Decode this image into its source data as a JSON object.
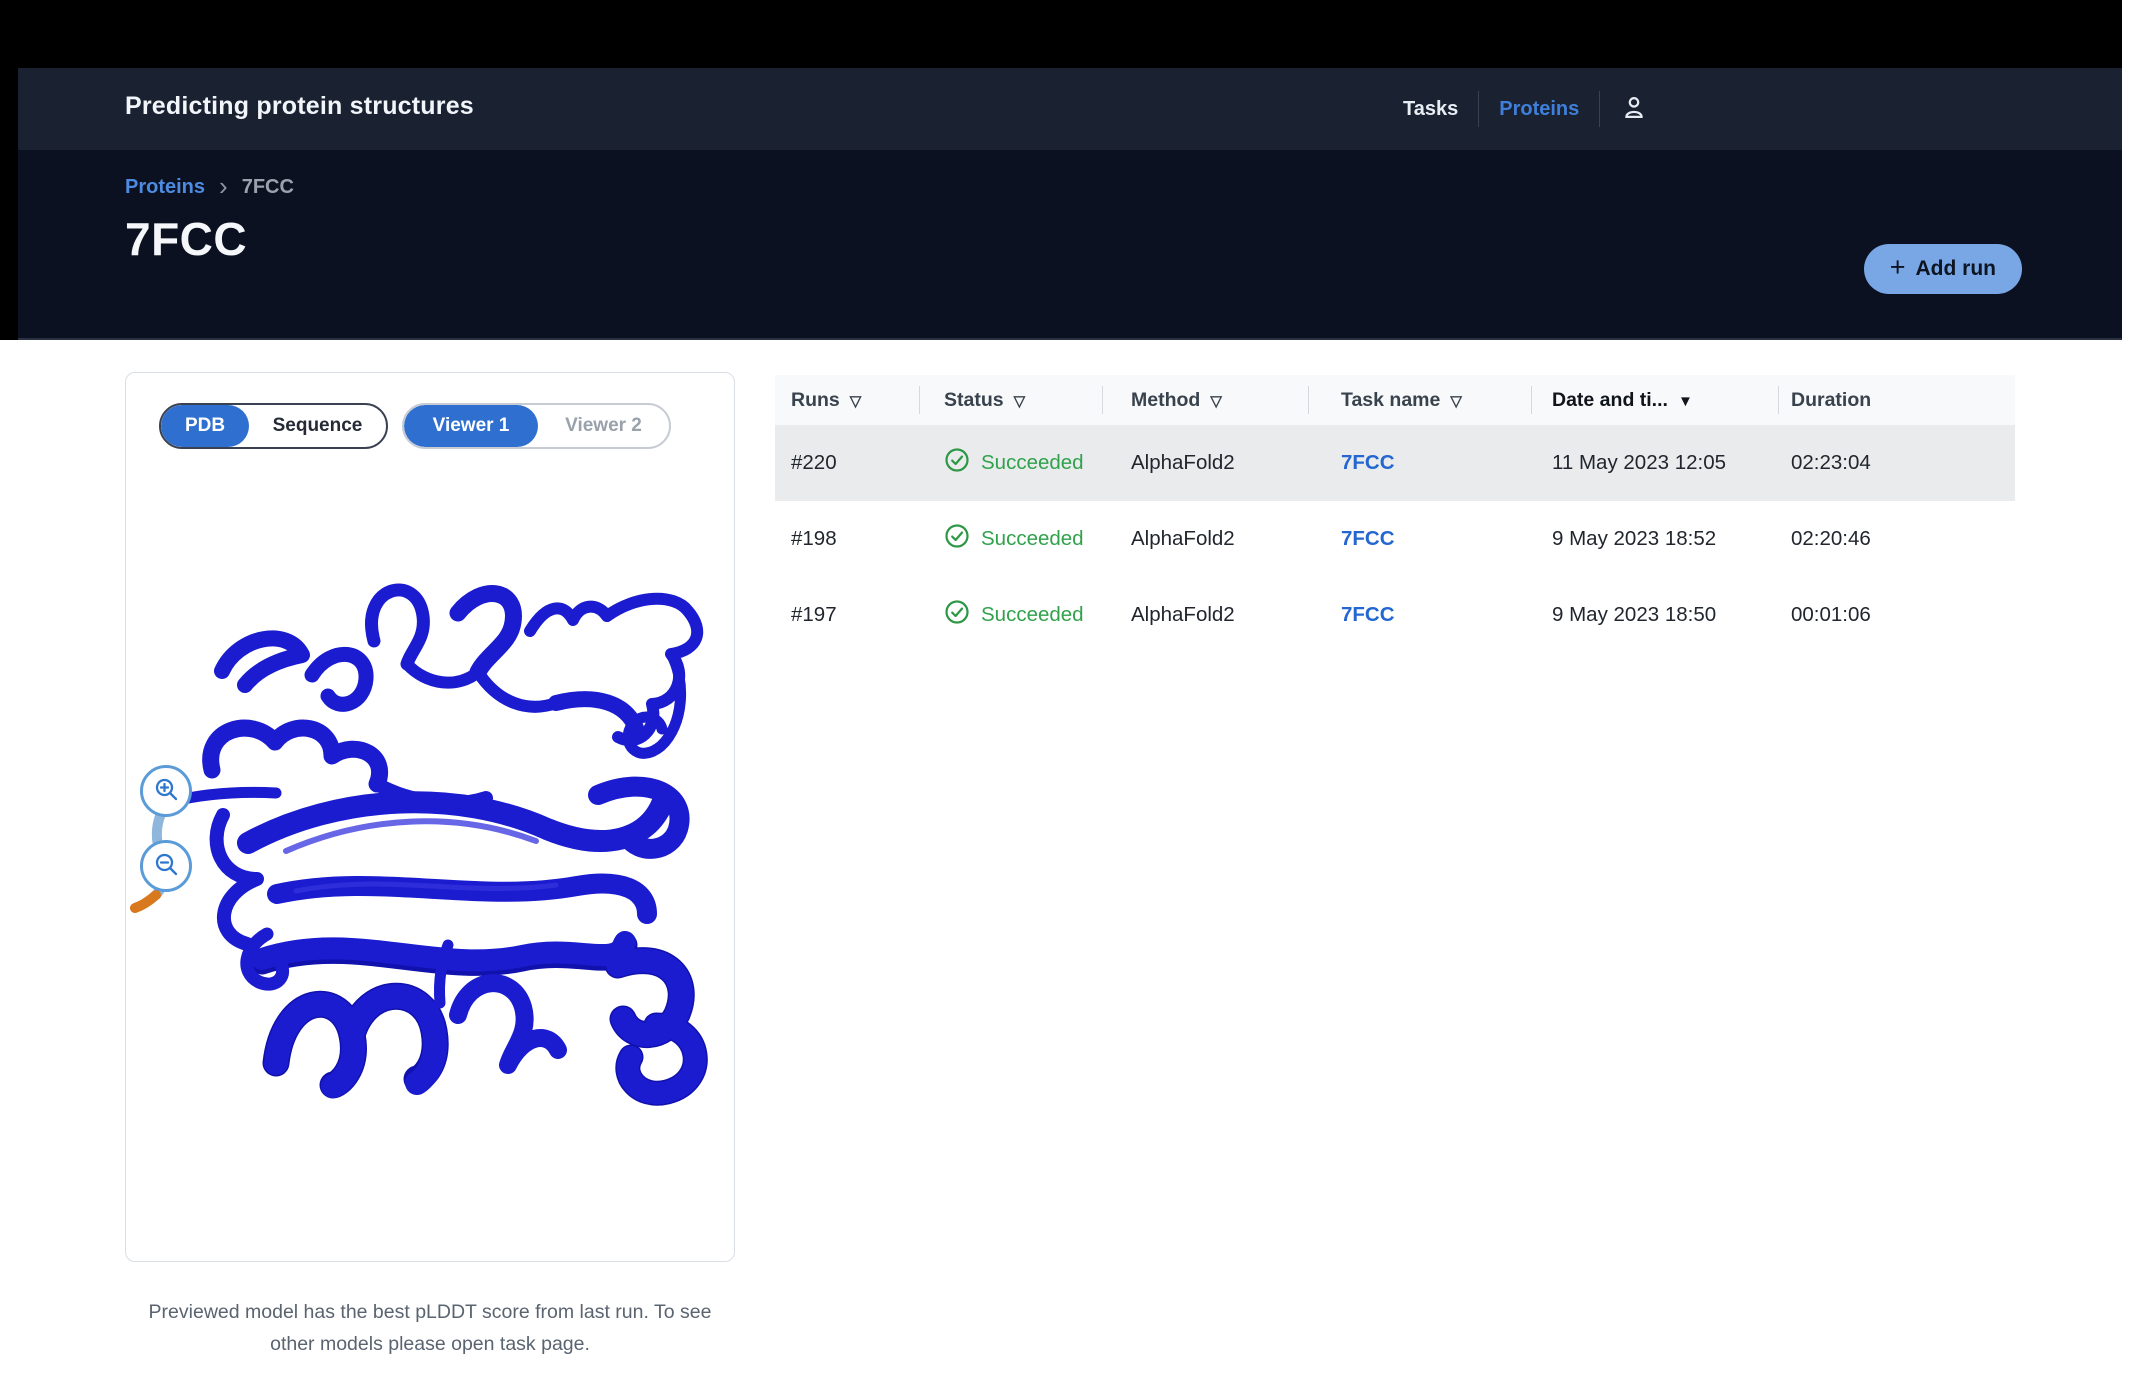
{
  "header": {
    "app_title": "Predicting protein structures",
    "nav": [
      {
        "label": "Tasks",
        "active": false
      },
      {
        "label": "Proteins",
        "active": true
      }
    ]
  },
  "breadcrumb": {
    "root": "Proteins",
    "current": "7FCC"
  },
  "hero": {
    "title": "7FCC",
    "add_run": {
      "label": "Add run"
    }
  },
  "viewer": {
    "format_toggle": {
      "options": [
        "PDB",
        "Sequence"
      ],
      "selected": "PDB"
    },
    "viewer_toggle": {
      "options": [
        "Viewer 1",
        "Viewer 2"
      ],
      "selected": "Viewer 1"
    },
    "caption": "Previewed model has the best pLDDT score from last run. To see other models please open task page."
  },
  "table": {
    "columns": [
      {
        "label": "Runs",
        "icon": "filter"
      },
      {
        "label": "Status",
        "icon": "filter"
      },
      {
        "label": "Method",
        "icon": "filter"
      },
      {
        "label": "Task name",
        "icon": "filter"
      },
      {
        "label": "Date and ti...",
        "icon": "sort-desc"
      },
      {
        "label": "Duration",
        "icon": ""
      }
    ],
    "rows": [
      {
        "run": "#220",
        "status": "Succeeded",
        "method": "AlphaFold2",
        "task_name": "7FCC",
        "date": "11 May 2023 12:05",
        "duration": "02:23:04",
        "highlighted": true
      },
      {
        "run": "#198",
        "status": "Succeeded",
        "method": "AlphaFold2",
        "task_name": "7FCC",
        "date": "9 May 2023 18:52",
        "duration": "02:20:46",
        "highlighted": false
      },
      {
        "run": "#197",
        "status": "Succeeded",
        "method": "AlphaFold2",
        "task_name": "7FCC",
        "date": "9 May 2023 18:50",
        "duration": "00:01:06",
        "highlighted": false
      }
    ]
  },
  "icons": {
    "filter": "▽",
    "sort_desc": "▼",
    "plus": "+",
    "chevron": "›"
  },
  "colors": {
    "accent_blue": "#2e6fd0",
    "link_blue": "#2467d1",
    "success_green": "#31a24c",
    "add_run_bg": "#79a7e6",
    "row_highlight": "#e9ebed",
    "nav_band": "#1a2231",
    "hero_dark": "#0b1120",
    "protein_blue": "#1b1bd0",
    "tail_light_blue": "#8fb6db",
    "tail_orange": "#d8791f"
  }
}
